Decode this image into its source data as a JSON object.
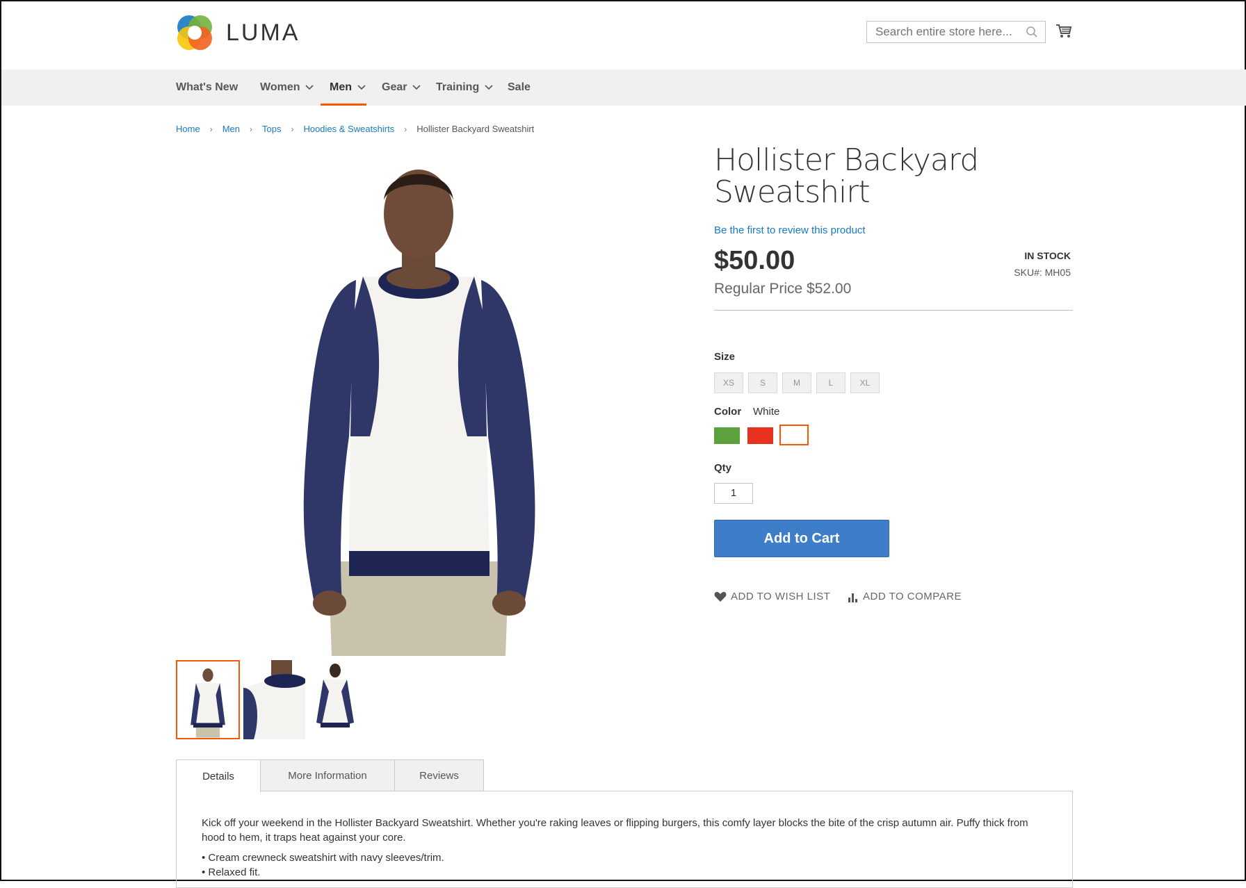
{
  "header": {
    "logo_text": "LUMA",
    "search_placeholder": "Search entire store here...",
    "colors": {
      "accent": "#ff5501",
      "link": "#1979c3",
      "button": "#3e7dc8"
    }
  },
  "nav": {
    "items": [
      {
        "label": "What's New"
      },
      {
        "label": "Women"
      },
      {
        "label": "Men"
      },
      {
        "label": "Gear"
      },
      {
        "label": "Training"
      },
      {
        "label": "Sale"
      }
    ],
    "active": "Men"
  },
  "breadcrumb": {
    "links": [
      "Home",
      "Men",
      "Tops",
      "Hoodies & Sweatshirts"
    ],
    "current": "Hollister Backyard Sweatshirt"
  },
  "product": {
    "title": "Hollister Backyard Sweatshirt",
    "review_link": "Be the first to review this product",
    "price": "$50.00",
    "regular_price": "Regular Price $52.00",
    "stock": "IN STOCK",
    "sku": "SKU#:  MH05",
    "size_label": "Size",
    "sizes": [
      "XS",
      "S",
      "M",
      "L",
      "XL"
    ],
    "color_label": "Color",
    "color_selected": "White",
    "colors": [
      {
        "name": "green",
        "hex": "#5da13d"
      },
      {
        "name": "red",
        "hex": "#e8321f"
      },
      {
        "name": "white",
        "hex": "#ffffff"
      }
    ],
    "qty_label": "Qty",
    "qty_value": "1",
    "add_to_cart": "Add to Cart",
    "wishlist": "ADD TO WISH LIST",
    "compare": "ADD TO COMPARE"
  },
  "tabs": {
    "items": [
      "Details",
      "More Information",
      "Reviews"
    ],
    "active": "Details"
  },
  "details": {
    "description": "Kick off your weekend in the Hollister Backyard Sweatshirt. Whether you're raking leaves or flipping burgers, this comfy layer blocks the bite of the crisp autumn air. Puffy thick from hood to hem, it traps heat against your core.",
    "bullets": [
      "• Cream crewneck sweatshirt with navy sleeves/trim.",
      "• Relaxed fit."
    ]
  }
}
